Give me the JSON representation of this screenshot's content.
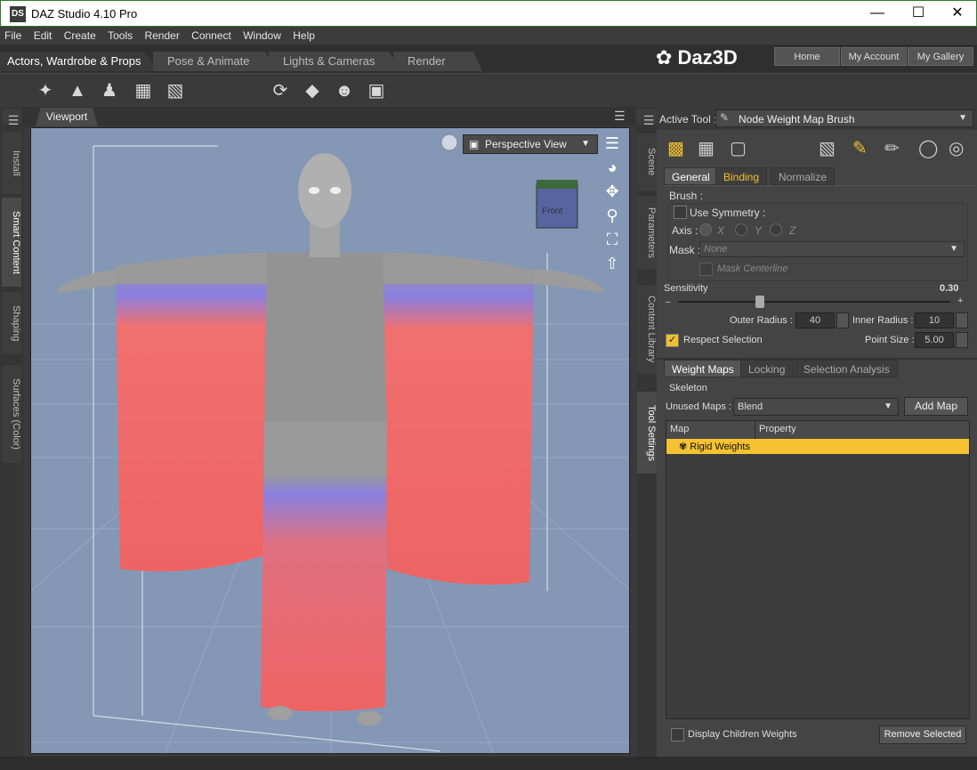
{
  "window": {
    "title": "DAZ Studio 4.10 Pro",
    "app_icon": "DS"
  },
  "menu": [
    "File",
    "Edit",
    "Create",
    "Tools",
    "Render",
    "Connect",
    "Window",
    "Help"
  ],
  "rooms": [
    "Actors, Wardrobe & Props",
    "Pose & Animate",
    "Lights & Cameras",
    "Render"
  ],
  "brand": "Daz3D",
  "top_buttons": [
    "Home",
    "My Account",
    "My Gallery"
  ],
  "left_tabs": [
    "Install",
    "Smart Content",
    "Shaping",
    "Surfaces (Color)"
  ],
  "right_tabs": [
    "Scene",
    "Parameters",
    "Content Library",
    "Tool Settings"
  ],
  "viewport": {
    "tab": "Viewport",
    "view": "Perspective View",
    "cube_label": "Front"
  },
  "tool_settings": {
    "active_tool_label": "Active Tool :",
    "active_tool": "Node Weight Map Brush",
    "tabs": [
      "General",
      "Binding",
      "Normalize"
    ],
    "brush_label": "Brush :",
    "use_symmetry": "Use Symmetry :",
    "axis_label": "Axis :",
    "axis_options": [
      "X",
      "Y",
      "Z"
    ],
    "mask_label": "Mask :",
    "mask_value": "None",
    "mask_centerline": "Mask Centerline",
    "sensitivity_label": "Sensitivity",
    "sensitivity_value": "0.30",
    "sensitivity": 0.3,
    "outer_radius_label": "Outer Radius :",
    "outer_radius": "40",
    "inner_radius_label": "Inner Radius :",
    "inner_radius": "10",
    "respect_selection": "Respect Selection",
    "point_size_label": "Point Size :",
    "point_size": "5.00",
    "section_tabs": [
      "Weight Maps",
      "Locking",
      "Selection Analysis"
    ],
    "skeleton_label": "Skeleton",
    "unused_maps_label": "Unused Maps :",
    "unused_maps_value": "Blend",
    "add_map": "Add Map",
    "table_headers": [
      "Map",
      "Property"
    ],
    "selected_row": "Rigid Weights",
    "display_children": "Display Children Weights",
    "remove_selected": "Remove Selected"
  },
  "colors": {
    "accent": "#f0c030",
    "viewport_bg": "#8497b5",
    "highlight_row": "#f6c232"
  }
}
